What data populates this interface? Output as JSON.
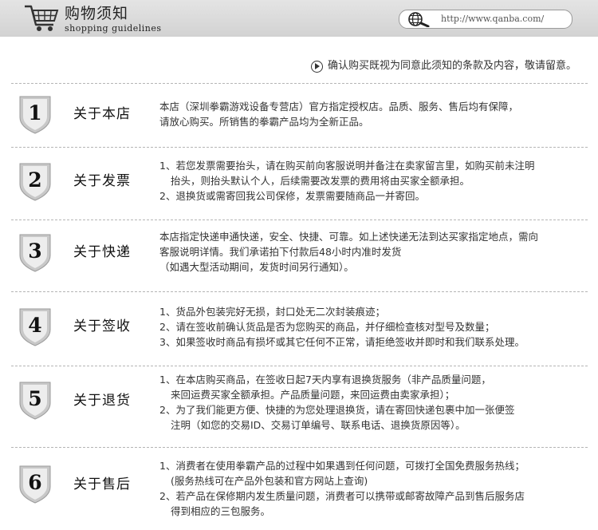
{
  "header": {
    "title_cn": "购物须知",
    "title_en": "shopping guidelines",
    "url": "http://www.qanba.com/"
  },
  "notice": "确认购买既视为同意此须知的条款及内容，敬请留意。",
  "sections": [
    {
      "number": "1",
      "title": "关于本店",
      "lines": [
        "本店（深圳拳霸游戏设备专营店）官方指定授权店。品质、服务、售后均有保障，",
        "请放心购买。所销售的拳霸产品均为全新正品。"
      ]
    },
    {
      "number": "2",
      "title": "关于发票",
      "lines": [
        "1、若您发票需要抬头，请在购买前向客服说明并备注在卖家留言里，如购买前未注明",
        "   抬头，则抬头默认个人，后续需要改发票的费用将由买家全额承担。",
        "2、退换货或需寄回我公司保修，发票需要随商品一并寄回。"
      ]
    },
    {
      "number": "3",
      "title": "关于快递",
      "lines": [
        "本店指定快递申通快递，安全、快捷、可靠。如上述快递无法到达买家指定地点，需向",
        "客服说明详情。我们承诺拍下付款后48小时内准时发货",
        "（如遇大型活动期间，发货时间另行通知）。"
      ]
    },
    {
      "number": "4",
      "title": "关于签收",
      "lines": [
        "1、货品外包装完好无损，封口处无二次封装痕迹；",
        "2、请在签收前确认货品是否为您购买的商品，并仔细检查核对型号及数量；",
        "3、如果签收时商品有损坏或其它任何不正常，请拒绝签收并即时和我们联系处理。"
      ]
    },
    {
      "number": "5",
      "title": "关于退货",
      "lines": [
        "1、在本店购买商品，在签收日起7天内享有退换货服务（非产品质量问题，",
        "   来回运费买家全额承担。产品质量问题，来回运费由卖家承担）；",
        "2、为了我们能更方便、快捷的为您处理退换货，请在寄回快递包裹中加一张便签",
        "   注明（如您的交易ID、交易订单编号、联系电话、退换货原因等）。"
      ]
    },
    {
      "number": "6",
      "title": "关于售后",
      "lines": [
        "1、消费者在使用拳霸产品的过程中如果遇到任何问题，可拨打全国免费服务热线；",
        "   (服务热线可在产品外包装和官方网站上查询)",
        "2、若产品在保修期内发生质量问题，消费者可以携带或邮寄故障产品到售后服务店",
        "   得到相应的三包服务。"
      ]
    }
  ]
}
